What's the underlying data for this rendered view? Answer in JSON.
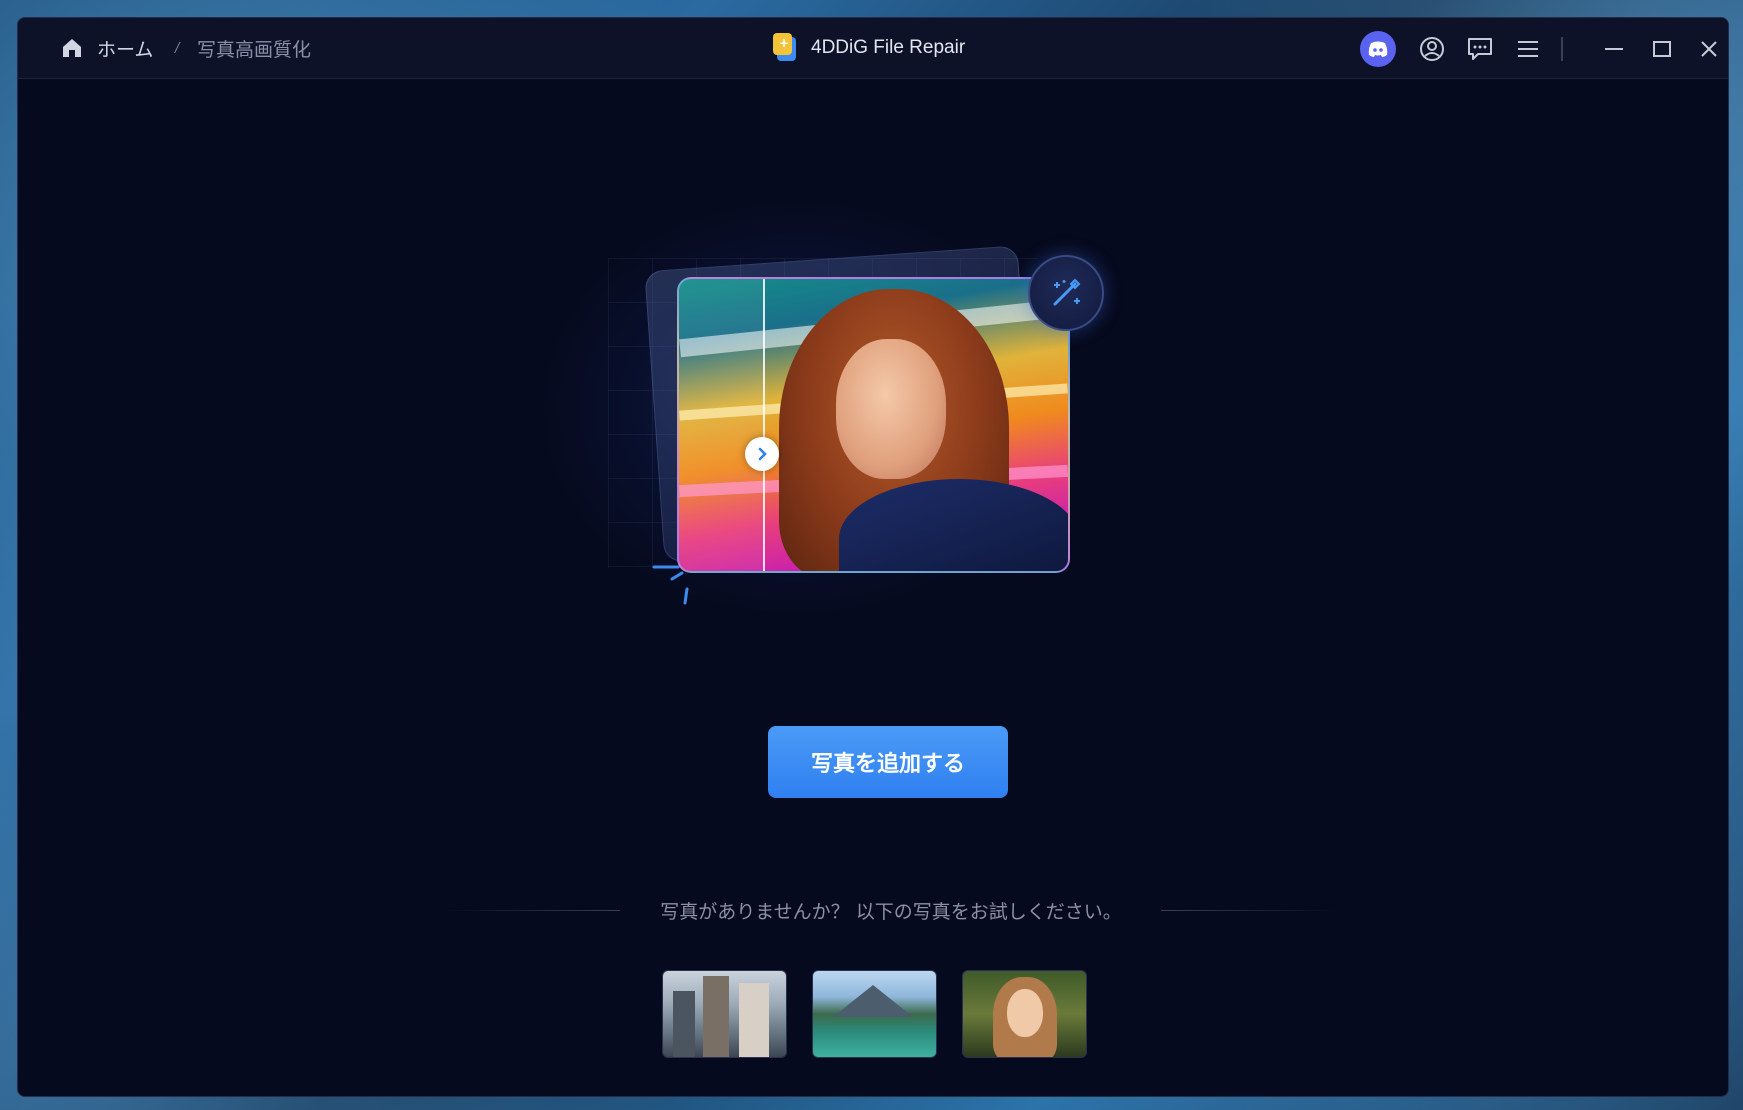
{
  "titlebar": {
    "breadcrumb": {
      "home_label": "ホーム",
      "separator": "/",
      "current_label": "写真高画質化"
    },
    "app_name": "4DDiG File Repair",
    "icons": {
      "home": "home-icon",
      "discord": "discord-icon",
      "account": "user-circle-icon",
      "feedback": "chat-icon",
      "menu": "hamburger-menu-icon",
      "minimize": "minimize-icon",
      "maximize": "maximize-icon",
      "close": "close-icon"
    }
  },
  "main": {
    "hero_icons": {
      "slider": "chevron-right-icon",
      "wand": "magic-wand-icon"
    },
    "add_button_label": "写真を追加する",
    "sample_prompt": "写真がありませんか？ 以下の写真をお試しください。",
    "samples": [
      {
        "name": "city-buildings-sample"
      },
      {
        "name": "mountain-lake-sample"
      },
      {
        "name": "portrait-woman-sample"
      }
    ]
  },
  "colors": {
    "window_bg": "#060a1e",
    "titlebar_bg": "#0d1229",
    "accent_blue": "#3b8bf0",
    "discord": "#5a63f0",
    "muted_text": "#8b90a7"
  }
}
